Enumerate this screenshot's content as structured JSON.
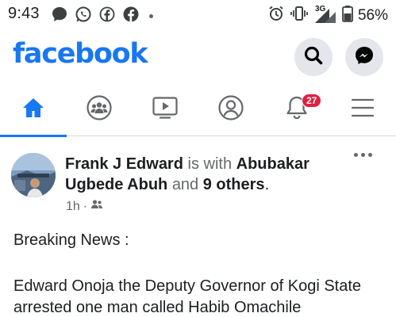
{
  "status_bar": {
    "time": "9:43",
    "network": "3G",
    "battery": "56%",
    "left_icons": [
      "chat-bubble-icon",
      "whatsapp-icon",
      "facebook-outline-icon",
      "facebook-icon",
      "dot-icon"
    ],
    "right_icons": [
      "alarm-icon",
      "vibrate-icon",
      "signal-icon",
      "battery-icon"
    ]
  },
  "header": {
    "logo": "facebook",
    "brand_color": "#1877f2",
    "buttons": [
      "search-icon",
      "messenger-icon"
    ]
  },
  "tabs": [
    {
      "name": "home",
      "icon": "home-icon",
      "active": true
    },
    {
      "name": "groups",
      "icon": "groups-icon",
      "active": false
    },
    {
      "name": "watch",
      "icon": "watch-icon",
      "active": false
    },
    {
      "name": "profile",
      "icon": "profile-icon",
      "active": false
    },
    {
      "name": "notifications",
      "icon": "bell-icon",
      "active": false,
      "badge": "27"
    },
    {
      "name": "menu",
      "icon": "menu-icon",
      "active": false
    }
  ],
  "post": {
    "author": "Frank J Edward",
    "with_text": "is with",
    "tagged": "Abubakar Ugbede Abuh",
    "and_text": "and",
    "others": "9 others",
    "period": ".",
    "time": "1h",
    "separator": "·",
    "audience_icon": "friends-icon",
    "text_line_1": "Breaking News :",
    "text_line_2": "Edward Onoja the Deputy Governor of Kogi State  arrested one man called Habib Omachile"
  }
}
